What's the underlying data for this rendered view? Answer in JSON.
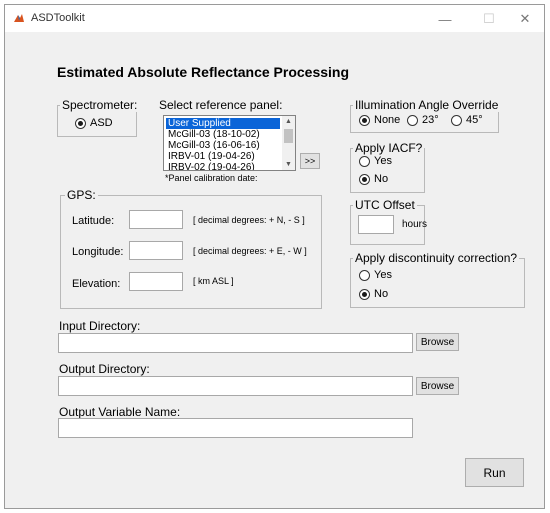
{
  "window": {
    "title": "ASDToolkit",
    "controls": {
      "minimize": "—",
      "maximize": "☐",
      "close": "✕"
    }
  },
  "heading": "Estimated Absolute Reflectance Processing",
  "spectrometer": {
    "title": "Spectrometer:",
    "option": "ASD",
    "selected": true
  },
  "reference_panel": {
    "label": "Select reference panel:",
    "items": [
      "User Supplied",
      "McGill-03 (18-10-02)",
      "McGill-03 (16-06-16)",
      "IRBV-01 (19-04-26)",
      "IRBV-02 (19-04-26)"
    ],
    "selected_index": 0,
    "note": "*Panel calibration date:",
    "add_button": ">>"
  },
  "gps": {
    "title": "GPS:",
    "latitude": {
      "label": "Latitude:",
      "value": "",
      "hint": "[ decimal degrees: + N, - S ]"
    },
    "longitude": {
      "label": "Longitude:",
      "value": "",
      "hint": "[ decimal degrees: + E, - W ]"
    },
    "elevation": {
      "label": "Elevation:",
      "value": "",
      "hint": "[ km ASL ]"
    }
  },
  "illumination": {
    "title": "Illumination Angle Override",
    "options": [
      "None",
      "23°",
      "45°"
    ],
    "selected": "None"
  },
  "iacf": {
    "title": "Apply IACF?",
    "yes": "Yes",
    "no": "No",
    "selected": "No"
  },
  "utc": {
    "title": "UTC Offset",
    "value": "",
    "unit": "hours"
  },
  "discontinuity": {
    "title": "Apply discontinuity correction?",
    "yes": "Yes",
    "no": "No",
    "selected": "No"
  },
  "input_dir": {
    "label": "Input Directory:",
    "value": "",
    "button": "Browse"
  },
  "output_dir": {
    "label": "Output Directory:",
    "value": "",
    "button": "Browse"
  },
  "output_var": {
    "label": "Output Variable Name:",
    "value": ""
  },
  "run_button": "Run"
}
